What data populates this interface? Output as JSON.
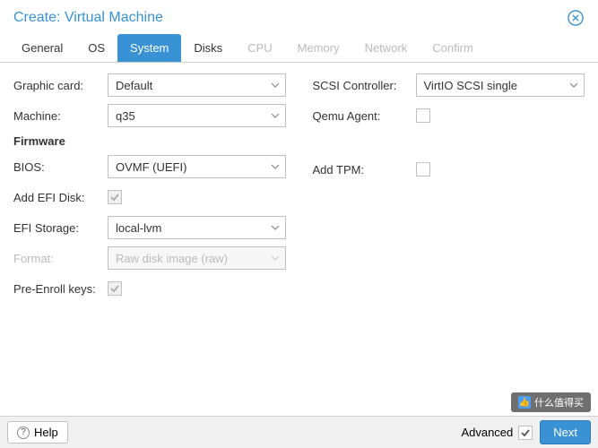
{
  "title": "Create: Virtual Machine",
  "tabs": [
    {
      "label": "General",
      "state": "normal"
    },
    {
      "label": "OS",
      "state": "normal"
    },
    {
      "label": "System",
      "state": "active"
    },
    {
      "label": "Disks",
      "state": "normal"
    },
    {
      "label": "CPU",
      "state": "disabled"
    },
    {
      "label": "Memory",
      "state": "disabled"
    },
    {
      "label": "Network",
      "state": "disabled"
    },
    {
      "label": "Confirm",
      "state": "disabled"
    }
  ],
  "left": {
    "graphic_card": {
      "label": "Graphic card:",
      "value": "Default"
    },
    "machine": {
      "label": "Machine:",
      "value": "q35"
    },
    "firmware_section": "Firmware",
    "bios": {
      "label": "BIOS:",
      "value": "OVMF (UEFI)"
    },
    "add_efi_disk": {
      "label": "Add EFI Disk:",
      "checked": true,
      "disabled": true
    },
    "efi_storage": {
      "label": "EFI Storage:",
      "value": "local-lvm"
    },
    "format": {
      "label": "Format:",
      "value": "Raw disk image (raw)",
      "disabled": true
    },
    "pre_enroll": {
      "label": "Pre-Enroll keys:",
      "checked": true,
      "disabled": true
    }
  },
  "right": {
    "scsi": {
      "label": "SCSI Controller:",
      "value": "VirtIO SCSI single"
    },
    "qemu_agent": {
      "label": "Qemu Agent:",
      "checked": false
    },
    "add_tpm": {
      "label": "Add TPM:",
      "checked": false
    }
  },
  "footer": {
    "help": "Help",
    "advanced": "Advanced",
    "advanced_checked": true,
    "next": "Next"
  },
  "watermark": "什么值得买"
}
